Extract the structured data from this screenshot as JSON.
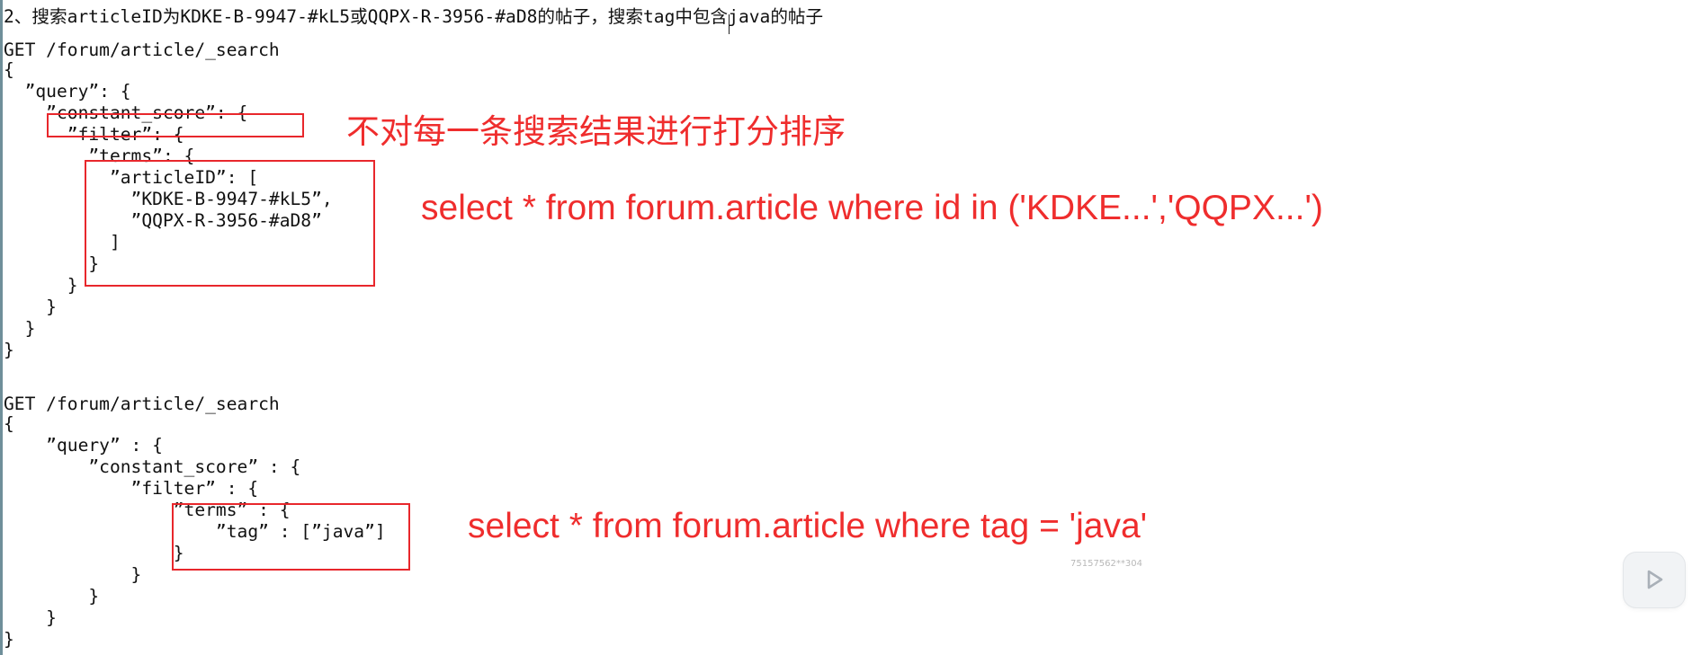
{
  "heading": "2、搜索articleID为KDKE-B-9947-#kL5或QQPX-R-3956-#aD8的帖子，搜索tag中包含java的帖子",
  "query1": {
    "request_line": "GET /forum/article/_search",
    "body": "{\n  ”query”: {\n    ”constant_score”: {\n      ”filter”: {\n        ”terms”: {\n          ”articleID”: [\n            ”KDKE-B-9947-#kL5”,\n            ”QQPX-R-3956-#aD8”\n          ]\n        }\n      }\n    }\n  }\n}"
  },
  "query2": {
    "request_line": "GET /forum/article/_search",
    "body": "{\n    ”query” : {\n        ”constant_score” : {\n            ”filter” : {\n                ”terms” : {\n                    ”tag” : [”java”]\n                }\n            }\n        }\n    }\n}"
  },
  "annotations": {
    "no_scoring": "不对每一条搜索结果进行打分排序",
    "sql_id_in": "select * from forum.article where id in ('KDKE...','QQPX...')",
    "sql_tag": "select * from forum.article where tag = 'java'"
  },
  "watermark": "75157562**304",
  "player": {
    "icon": "play-icon"
  },
  "colors": {
    "annotation": "#e8272c",
    "text": "#111111"
  }
}
